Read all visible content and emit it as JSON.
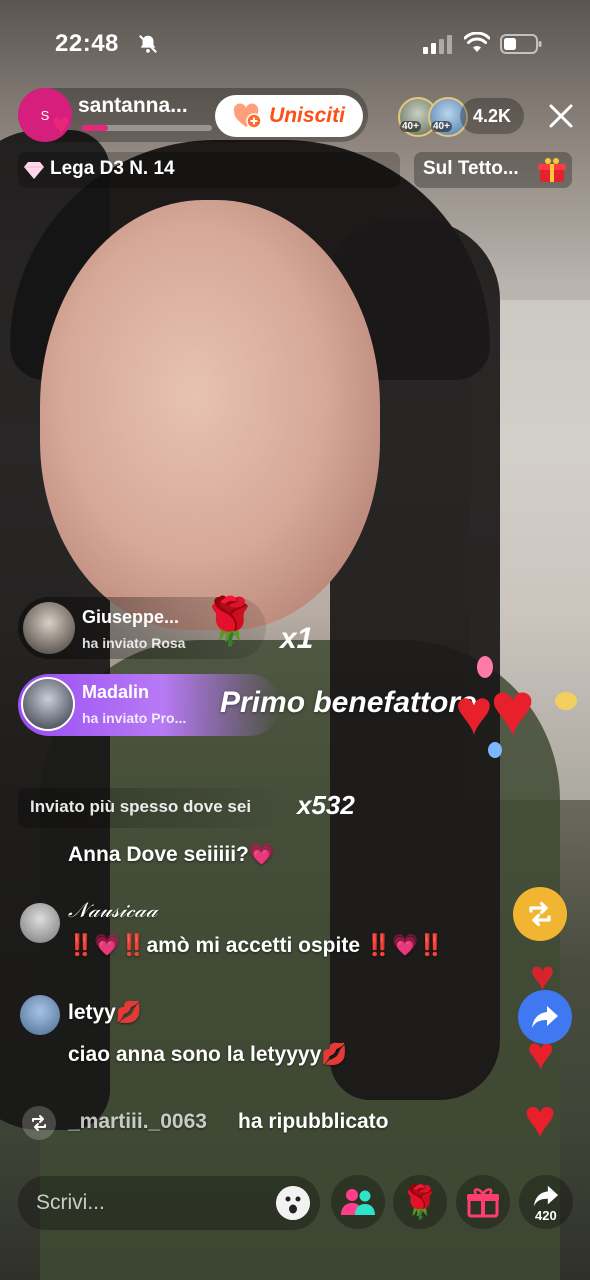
{
  "status_bar": {
    "time": "22:48"
  },
  "header": {
    "host_initial": "S",
    "host_name": "santanna...",
    "host_progress": 0.2,
    "join_label": "Unisciti",
    "viewer_badges": [
      "40+",
      "40+"
    ],
    "viewer_count": "4.2K"
  },
  "subheader": {
    "league_label": "Lega D3 N. 14",
    "roof_label": "Sul Tetto..."
  },
  "gifts": [
    {
      "name": "Giuseppe...",
      "subtitle": "ha inviato Rosa",
      "multiplier": "x1"
    },
    {
      "name": "Madalin",
      "subtitle": "ha inviato Pro...",
      "banner": "Primo benefattore"
    }
  ],
  "most_sent": {
    "label": "Inviato più spesso dove sei",
    "multiplier": "x532"
  },
  "chat": [
    {
      "text": "Anna Dove seiiiii?💗"
    },
    {
      "user": "𝒩𝒶𝓊𝓈𝒾𝒸𝒶𝒶",
      "text": "‼️💗‼️amò mi accetti ospite ‼️💗‼️"
    },
    {
      "user": "letyy💋",
      "text": "ciao anna sono la letyyyy💋"
    },
    {
      "user": "_martiii._0063",
      "text": "ha ripubblicato"
    }
  ],
  "bottom_bar": {
    "input_placeholder": "Scrivi...",
    "share_count": "420"
  },
  "colors": {
    "accent_pink": "#e8277c",
    "join_orange": "#ff4f14",
    "gift_purple": "#9a4df2",
    "repost_yellow": "#f2b531",
    "share_blue": "#3f78f0"
  }
}
